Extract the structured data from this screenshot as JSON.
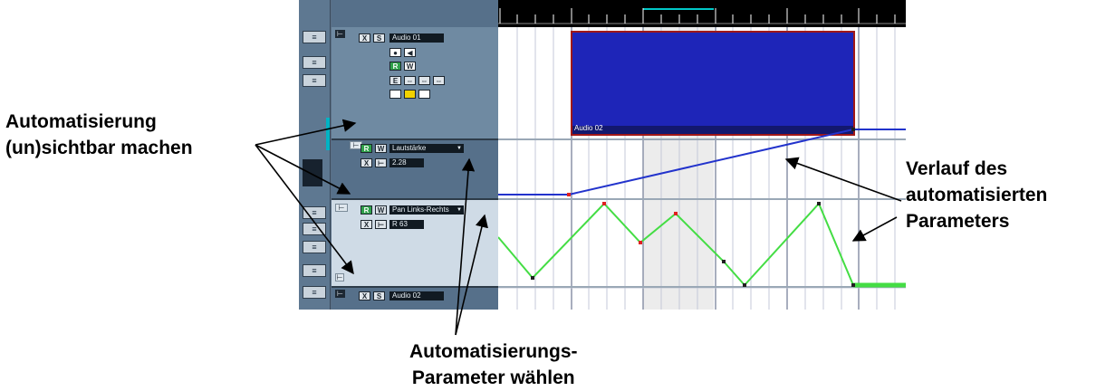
{
  "callouts": {
    "visibility": [
      "Automatisierung",
      "(un)sichtbar machen"
    ],
    "curve": [
      "Verlauf des",
      "automatisierten",
      "Parameters"
    ],
    "parameter": [
      "Automatisierungs-",
      "Parameter wählen"
    ]
  },
  "track_audio01": {
    "name": "Audio 01",
    "buttons": [
      "●",
      "◀",
      "R",
      "W",
      "E",
      "⇔",
      "⇔",
      "⇔"
    ],
    "mute_label": "X",
    "solo_label": "S"
  },
  "track_volume": {
    "read_label": "R",
    "write_label": "W",
    "parameter": "Lautstärke",
    "value": "2.28"
  },
  "track_pan": {
    "read_label": "R",
    "write_label": "W",
    "parameter": "Pan Links-Rechts",
    "value": "R 63"
  },
  "track_audio02": {
    "name": "Audio 02",
    "mute_label": "X",
    "solo_label": "S"
  },
  "region": {
    "name": "Audio 02"
  },
  "colors": {
    "volume_curve": "#2233cc",
    "pan_curve": "#44dd44",
    "region_fill": "#1e25b8",
    "ruler_loop": "#00c8c8"
  }
}
